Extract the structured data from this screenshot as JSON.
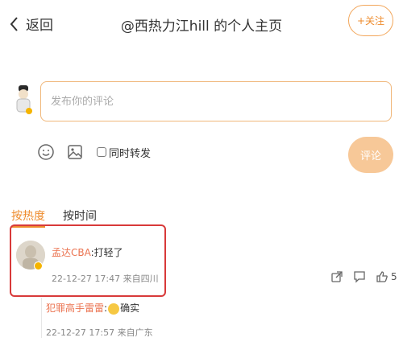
{
  "header": {
    "back_label": "返回",
    "title": "@西热力江hill 的个人主页",
    "follow_label": "+关注"
  },
  "composer": {
    "placeholder": "发布你的评论",
    "repost_label": "同时转发",
    "submit_label": "评论"
  },
  "sort": {
    "tabs": [
      "按热度",
      "按时间"
    ],
    "active": "按热度"
  },
  "comment": {
    "user": "孟达CBA",
    "separator": ":",
    "text": "打轻了",
    "meta": "22-12-27 17:47 来自四川",
    "like_count": "5"
  },
  "reply": {
    "user": "犯罪高手雷雷",
    "separator": ":",
    "text": "确实",
    "meta": "22-12-27 17:57 来自广东"
  },
  "colors": {
    "accent": "#ee8b2c",
    "username": "#eb7350",
    "highlight_box": "#d83a3a",
    "submit_bg": "#f7c898"
  },
  "icons": {
    "back": "chevron-left-icon",
    "emoji": "emoji-icon",
    "image": "image-icon",
    "share": "share-icon",
    "reply": "comment-icon",
    "like": "thumbs-up-icon"
  }
}
